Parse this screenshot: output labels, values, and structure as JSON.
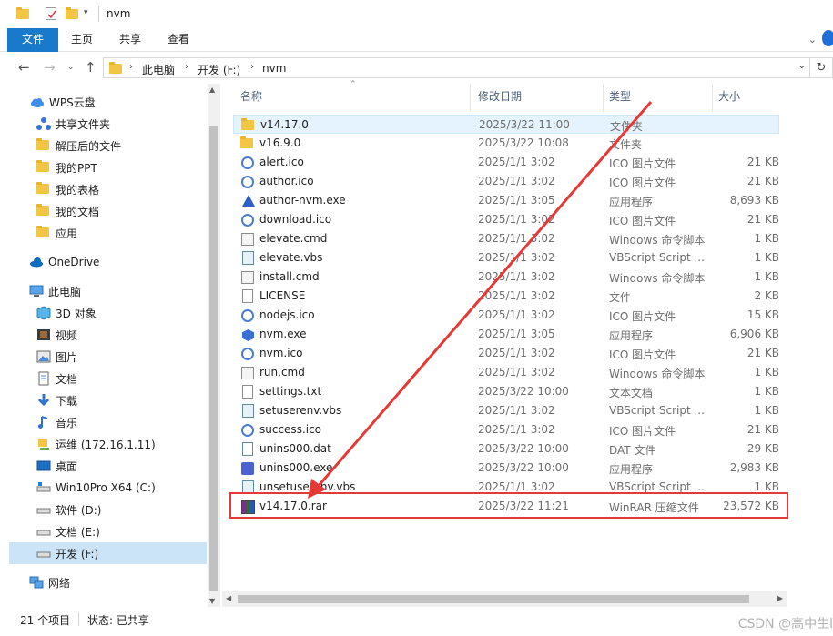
{
  "window": {
    "title": "nvm"
  },
  "ribbon": {
    "tabs": [
      "文件",
      "主页",
      "共享",
      "查看"
    ]
  },
  "address": {
    "crumbs": [
      "此电脑",
      "开发 (F:)",
      "nvm"
    ]
  },
  "navpane": {
    "items": [
      {
        "label": "WPS云盘",
        "icon": "cloud-icon"
      },
      {
        "label": "共享文件夹",
        "icon": "share-icon"
      },
      {
        "label": "解压后的文件",
        "icon": "folder-icon"
      },
      {
        "label": "我的PPT",
        "icon": "folder-icon"
      },
      {
        "label": "我的表格",
        "icon": "folder-icon"
      },
      {
        "label": "我的文档",
        "icon": "folder-icon"
      },
      {
        "label": "应用",
        "icon": "folder-icon"
      },
      {
        "label": "OneDrive",
        "icon": "onedrive-icon"
      },
      {
        "label": "此电脑",
        "icon": "pc-icon"
      },
      {
        "label": "3D 对象",
        "icon": "cube-icon"
      },
      {
        "label": "视频",
        "icon": "video-icon"
      },
      {
        "label": "图片",
        "icon": "picture-icon"
      },
      {
        "label": "文档",
        "icon": "document-icon"
      },
      {
        "label": "下载",
        "icon": "download-icon"
      },
      {
        "label": "音乐",
        "icon": "music-icon"
      },
      {
        "label": "运维 (172.16.1.11)",
        "icon": "network-drive-icon"
      },
      {
        "label": "桌面",
        "icon": "desktop-icon"
      },
      {
        "label": "Win10Pro X64 (C:)",
        "icon": "drive-c-icon"
      },
      {
        "label": "软件 (D:)",
        "icon": "drive-icon"
      },
      {
        "label": "文档 (E:)",
        "icon": "drive-icon"
      },
      {
        "label": "开发 (F:)",
        "icon": "drive-icon"
      },
      {
        "label": "网络",
        "icon": "network-icon"
      }
    ]
  },
  "filelist": {
    "columns": [
      "名称",
      "修改日期",
      "类型",
      "大小"
    ],
    "rows": [
      {
        "name": "v14.17.0",
        "date": "2025/3/22 11:00",
        "type": "文件夹",
        "size": "",
        "icon": "folder-icon"
      },
      {
        "name": "v16.9.0",
        "date": "2025/3/22 10:08",
        "type": "文件夹",
        "size": "",
        "icon": "folder-icon"
      },
      {
        "name": "alert.ico",
        "date": "2025/1/1 3:02",
        "type": "ICO 图片文件",
        "size": "21 KB",
        "icon": "ico-icon"
      },
      {
        "name": "author.ico",
        "date": "2025/1/1 3:02",
        "type": "ICO 图片文件",
        "size": "21 KB",
        "icon": "ico-icon"
      },
      {
        "name": "author-nvm.exe",
        "date": "2025/1/1 3:05",
        "type": "应用程序",
        "size": "8,693 KB",
        "icon": "app-icon"
      },
      {
        "name": "download.ico",
        "date": "2025/1/1 3:02",
        "type": "ICO 图片文件",
        "size": "21 KB",
        "icon": "ico-icon"
      },
      {
        "name": "elevate.cmd",
        "date": "2025/1/1 3:02",
        "type": "Windows 命令脚本",
        "size": "1 KB",
        "icon": "cmd-icon"
      },
      {
        "name": "elevate.vbs",
        "date": "2025/1/1 3:02",
        "type": "VBScript Script ...",
        "size": "1 KB",
        "icon": "vbs-icon"
      },
      {
        "name": "install.cmd",
        "date": "2025/1/1 3:02",
        "type": "Windows 命令脚本",
        "size": "1 KB",
        "icon": "cmd-icon"
      },
      {
        "name": "LICENSE",
        "date": "2025/1/1 3:02",
        "type": "文件",
        "size": "2 KB",
        "icon": "file-icon"
      },
      {
        "name": "nodejs.ico",
        "date": "2025/1/1 3:02",
        "type": "ICO 图片文件",
        "size": "15 KB",
        "icon": "ico-icon"
      },
      {
        "name": "nvm.exe",
        "date": "2025/1/1 3:05",
        "type": "应用程序",
        "size": "6,906 KB",
        "icon": "hex-icon"
      },
      {
        "name": "nvm.ico",
        "date": "2025/1/1 3:02",
        "type": "ICO 图片文件",
        "size": "21 KB",
        "icon": "ico-icon"
      },
      {
        "name": "run.cmd",
        "date": "2025/1/1 3:02",
        "type": "Windows 命令脚本",
        "size": "1 KB",
        "icon": "cmd-icon"
      },
      {
        "name": "settings.txt",
        "date": "2025/3/22 10:00",
        "type": "文本文档",
        "size": "1 KB",
        "icon": "text-icon"
      },
      {
        "name": "setuserenv.vbs",
        "date": "2025/1/1 3:02",
        "type": "VBScript Script ...",
        "size": "1 KB",
        "icon": "vbs-icon"
      },
      {
        "name": "success.ico",
        "date": "2025/1/1 3:02",
        "type": "ICO 图片文件",
        "size": "21 KB",
        "icon": "ico-icon"
      },
      {
        "name": "unins000.dat",
        "date": "2025/3/22 10:00",
        "type": "DAT 文件",
        "size": "29 KB",
        "icon": "dat-icon"
      },
      {
        "name": "unins000.exe",
        "date": "2025/3/22 10:00",
        "type": "应用程序",
        "size": "2,983 KB",
        "icon": "setup-icon"
      },
      {
        "name": "unsetuserenv.vbs",
        "date": "2025/1/1 3:02",
        "type": "VBScript Script ...",
        "size": "1 KB",
        "icon": "vbs-icon"
      },
      {
        "name": "v14.17.0.rar",
        "date": "2025/3/22 11:21",
        "type": "WinRAR 压缩文件",
        "size": "23,572 KB",
        "icon": "rar-icon"
      }
    ]
  },
  "status": {
    "count": "21 个项目",
    "state": "状态: 已共享"
  },
  "watermark": "CSDN @高中生l",
  "colors": {
    "accent": "#1979ca",
    "annotation": "#e53935",
    "selected": "#cce4f7",
    "highlight": "#e5f3ff"
  }
}
